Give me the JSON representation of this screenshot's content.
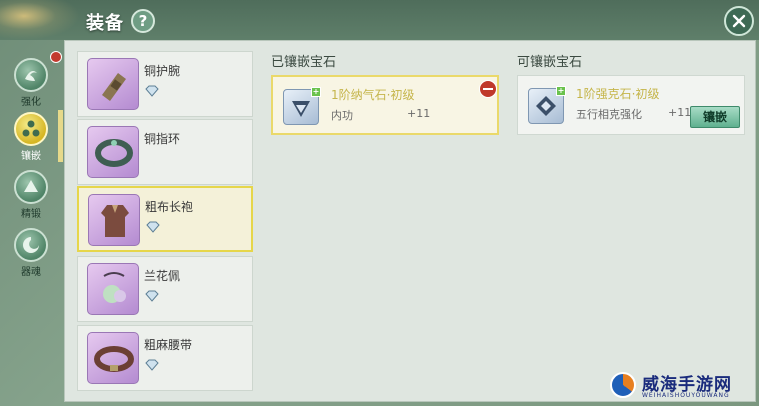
{
  "header": {
    "title": "装备",
    "help_label": "?"
  },
  "sidebar": {
    "tabs": [
      {
        "label": "强化",
        "icon": "strengthen-icon",
        "active": false
      },
      {
        "label": "镶嵌",
        "icon": "inlay-icon",
        "active": true
      },
      {
        "label": "精锻",
        "icon": "forge-icon",
        "active": false
      },
      {
        "label": "器魂",
        "icon": "soul-icon",
        "active": false
      }
    ]
  },
  "equipment": {
    "items": [
      {
        "name": "铜护腕",
        "icon": "bracer-icon",
        "selected": false
      },
      {
        "name": "铜指环",
        "icon": "ring-icon",
        "selected": false
      },
      {
        "name": "粗布长袍",
        "icon": "robe-icon",
        "selected": true
      },
      {
        "name": "兰花佩",
        "icon": "pendant-icon",
        "selected": false
      },
      {
        "name": "粗麻腰带",
        "icon": "belt-icon",
        "selected": false
      }
    ]
  },
  "inlaid": {
    "title": "已镶嵌宝石",
    "gem": {
      "name": "1阶纳气石·初级",
      "stat": "内功",
      "value": "+11"
    }
  },
  "available": {
    "title": "可镶嵌宝石",
    "gem": {
      "name": "1阶强克石·初级",
      "stat": "五行相克强化",
      "value": "+11",
      "button": "镶嵌"
    }
  },
  "watermark": {
    "main": "威海手游网",
    "sub": "WEIHAISHOUYOUWANG"
  },
  "colors": {
    "accent": "#e6d64a",
    "panel": "#dfe6e0",
    "button": "#5fb08f",
    "remove": "#c0392b"
  }
}
